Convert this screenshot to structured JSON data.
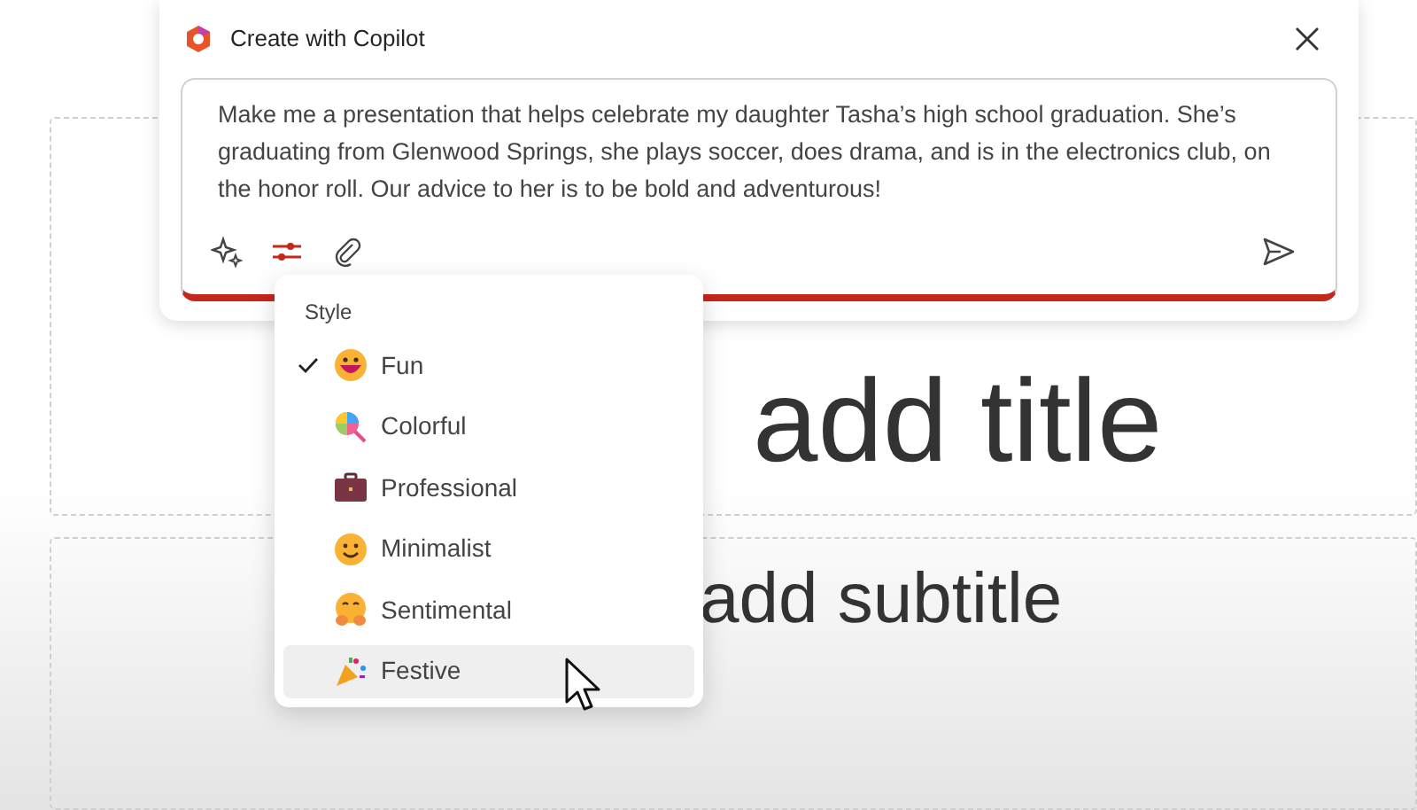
{
  "slide": {
    "title_placeholder": "add title",
    "subtitle_placeholder": "add subtitle"
  },
  "dialog": {
    "title": "Create with Copilot",
    "prompt": "Make me a presentation that helps celebrate my daughter Tasha’s high school graduation. She’s graduating from Glenwood Springs, she plays soccer, does drama, and is in the electronics club, on the honor roll. Our advice to her is to be bold and adventurous!",
    "style_menu_open": true
  },
  "style_menu": {
    "heading": "Style",
    "items": [
      {
        "label": "Fun",
        "kind": "grin",
        "selected": true,
        "hovered": false
      },
      {
        "label": "Colorful",
        "kind": "lollipop",
        "selected": false,
        "hovered": false
      },
      {
        "label": "Professional",
        "kind": "briefcase",
        "selected": false,
        "hovered": false
      },
      {
        "label": "Minimalist",
        "kind": "smile",
        "selected": false,
        "hovered": false
      },
      {
        "label": "Sentimental",
        "kind": "hug",
        "selected": false,
        "hovered": false
      },
      {
        "label": "Festive",
        "kind": "popper",
        "selected": false,
        "hovered": true
      }
    ]
  }
}
